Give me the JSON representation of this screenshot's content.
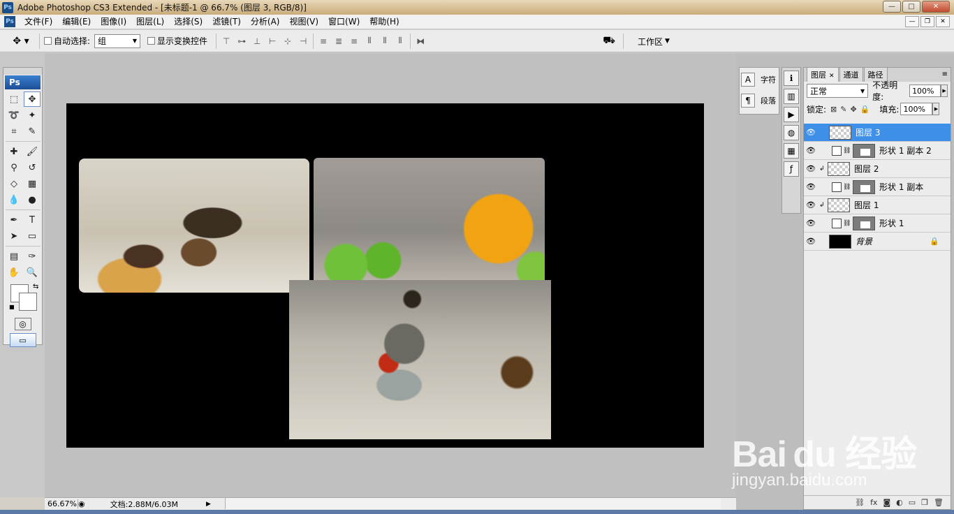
{
  "window": {
    "title": "Adobe Photoshop CS3 Extended - [未标题-1 @ 66.7% (图层 3, RGB/8)]",
    "app_icon": "Ps",
    "minimize": "—",
    "maximize": "□",
    "close": "✕"
  },
  "menu": {
    "items": [
      "文件(F)",
      "编辑(E)",
      "图像(I)",
      "图层(L)",
      "选择(S)",
      "滤镜(T)",
      "分析(A)",
      "视图(V)",
      "窗口(W)",
      "帮助(H)"
    ],
    "doc_minimize": "—",
    "doc_restore": "❐",
    "doc_close": "✕"
  },
  "options": {
    "auto_select_label": "自动选择:",
    "auto_select_value": "组",
    "show_transform_label": "显示变换控件",
    "workspace_label": "工作区"
  },
  "toolbox": {
    "logo": "Ps"
  },
  "status": {
    "zoom": "66.67%",
    "doc_info": "文档:2.88M/6.03M"
  },
  "dock": {
    "character_label": "字符",
    "paragraph_label": "段落"
  },
  "layers_panel": {
    "tabs": [
      "图层",
      "通道",
      "路径"
    ],
    "blend_mode": "正常",
    "opacity_label": "不透明度:",
    "opacity_value": "100%",
    "lock_label": "锁定:",
    "fill_label": "填充:",
    "fill_value": "100%",
    "layers": [
      {
        "name": "图层 3",
        "kind": "pixel",
        "selected": true
      },
      {
        "name": "形状 1 副本 2",
        "kind": "shape",
        "selected": false
      },
      {
        "name": "图层 2",
        "kind": "pixel-clipped",
        "selected": false
      },
      {
        "name": "形状 1 副本",
        "kind": "shape",
        "selected": false
      },
      {
        "name": "图层 1",
        "kind": "pixel-clipped",
        "selected": false
      },
      {
        "name": "形状 1",
        "kind": "shape",
        "selected": false
      },
      {
        "name": "背景",
        "kind": "background",
        "selected": false
      }
    ]
  },
  "watermark": {
    "logo": "Bai du 经验",
    "url": "jingyan.baidu.com"
  },
  "colors": {
    "selected_layer": "#3d8fe8",
    "canvas_background": "#000000",
    "workspace_gray": "#c0c0c0"
  }
}
